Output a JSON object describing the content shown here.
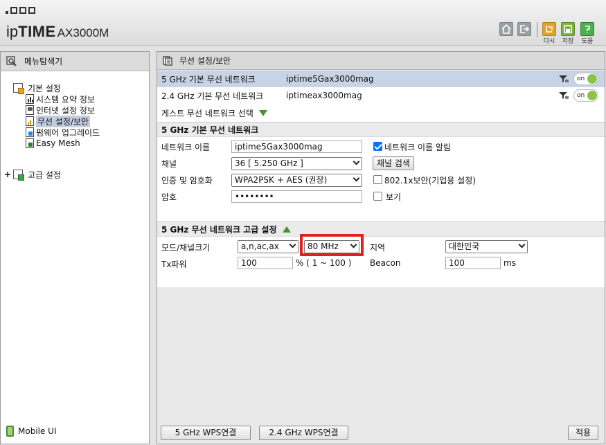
{
  "header": {
    "logo_ip": "ip",
    "logo_time": "TIME",
    "logo_model": "AX3000M",
    "buttons": [
      {
        "icon": "home-icon",
        "label": ""
      },
      {
        "icon": "logout-icon",
        "label": ""
      },
      {
        "icon": "reload-icon",
        "label": "다시"
      },
      {
        "icon": "save-icon",
        "label": "저장"
      },
      {
        "icon": "help-icon",
        "label": "도움"
      }
    ]
  },
  "sidebar": {
    "title": "메뉴탐색기",
    "groups": [
      {
        "label": "기본 설정",
        "items": [
          "시스템 요약 정보",
          "인터넷 설정 정보",
          "무선 설정/보안",
          "펌웨어 업그레이드",
          "Easy Mesh"
        ]
      },
      {
        "label": "고급 설정",
        "expand": "+"
      }
    ],
    "selected_item": "무선 설정/보안",
    "mobile_ui": "Mobile UI"
  },
  "main": {
    "title": "무선 설정/보안",
    "networks": [
      {
        "band": "5 GHz 기본 무선 네트워크",
        "ssid": "iptime5Gax3000mag",
        "toggle": "on",
        "active": true
      },
      {
        "band": "2.4 GHz 기본 무선 네트워크",
        "ssid": "iptimeax3000mag",
        "toggle": "on",
        "active": false
      }
    ],
    "guest_select": "게스트 무선 네트워크 선택",
    "basic": {
      "title": "5 GHz 기본 무선 네트워크",
      "network_name_label": "네트워크 이름",
      "network_name_value": "iptime5Gax3000mag",
      "broadcast_label": "네트워크 이름 알림",
      "broadcast_checked": true,
      "channel_label": "채널",
      "channel_value": "36 [ 5.250 GHz ]",
      "channel_scan_button": "채널 검색",
      "auth_label": "인증 및 암호화",
      "auth_value": "WPA2PSK + AES (권장)",
      "enterprise_label": "802.1x보안(기업용 설정)",
      "enterprise_checked": false,
      "password_label": "암호",
      "password_value": "••••••••",
      "show_label": "보기",
      "show_checked": false
    },
    "advanced": {
      "title": "5 GHz 무선 네트워크 고급 설정",
      "mode_label": "모드/채널크기",
      "mode_value": "a,n,ac,ax",
      "width_value": "80 MHz",
      "region_label": "지역",
      "region_value": "대한민국",
      "tx_label": "Tx파워",
      "tx_value": "100",
      "tx_unit": "% ( 1 ~ 100 )",
      "beacon_label": "Beacon",
      "beacon_value": "100",
      "beacon_unit": "ms"
    },
    "footer": {
      "wps5_button": "5 GHz WPS연결",
      "wps24_button": "2.4 GHz WPS연결",
      "apply_button": "적용"
    }
  },
  "colors": {
    "selected_row": "#c9d3e6",
    "toggle_on": "#8bc34a",
    "highlight": "#e02020",
    "triangle": "#4c8f2c"
  }
}
